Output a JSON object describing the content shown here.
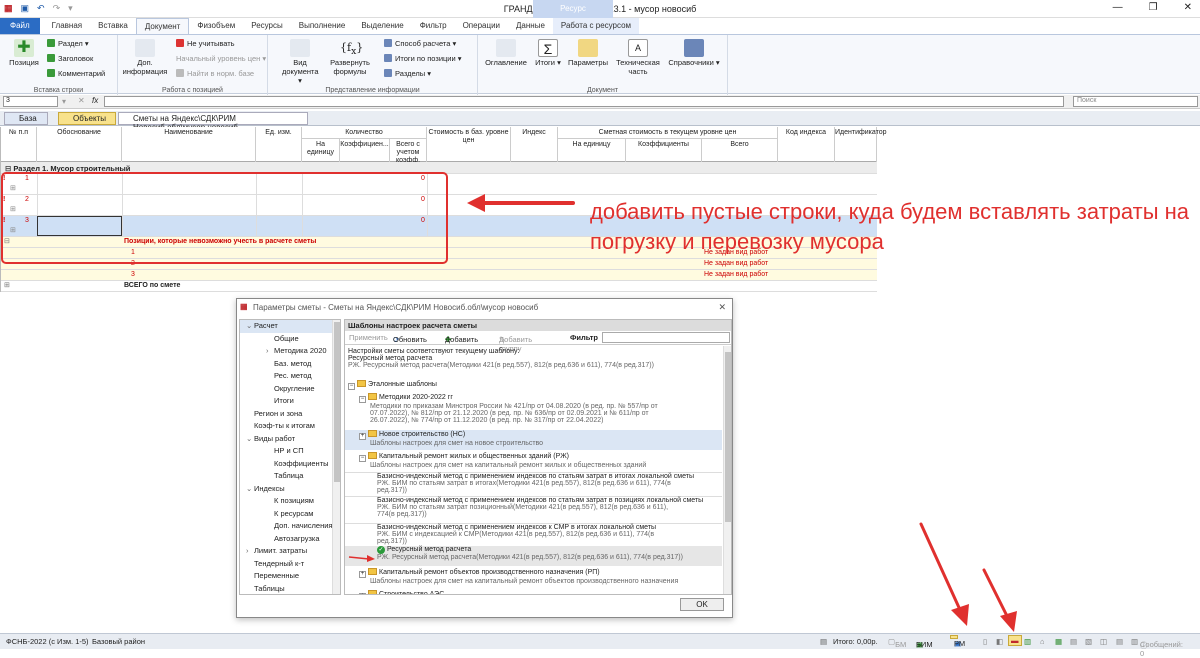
{
  "window": {
    "title": "ГРАНД-Смета, версия 2023.1 - мусор новосиб",
    "context_tab": "Ресурс",
    "controls": [
      "—",
      "❐",
      "✕"
    ]
  },
  "tabs": [
    "Файл",
    "Главная",
    "Вставка",
    "Документ",
    "Физобъем",
    "Ресурсы",
    "Выполнение",
    "Выделение",
    "Фильтр",
    "Операции",
    "Данные",
    "Работа с ресурсом"
  ],
  "ribbon": {
    "insert_row": {
      "position": "Позиция",
      "section": "Раздел",
      "header": "Заголовок",
      "comment": "Комментарий",
      "label": "Вставка строки"
    },
    "position_work": {
      "add_info": "Доп. информация",
      "no_count": "Не учитывать",
      "price_level": "Начальный уровень цен",
      "find_base": "Найти в норм. базе",
      "label": "Работа с позицией"
    },
    "info_view": {
      "doc_view": "Вид документа",
      "expand_formulas": "Развернуть формулы",
      "calc_method": "Способ расчета",
      "totals_pos": "Итоги по позиции",
      "sections": "Разделы",
      "label": "Представление информации"
    },
    "document": {
      "toc": "Оглавление",
      "totals": "Итоги",
      "params": "Параметры",
      "tech_part": "Техническая часть",
      "references": "Справочники",
      "label": "Документ"
    }
  },
  "formula_bar": {
    "cell": "3",
    "fx": "fx",
    "search_placeholder": "Поиск"
  },
  "doc_tabs": {
    "base": "База",
    "objects": "Объекты",
    "path": "Сметы на Яндекс\\СДК\\РИМ Новосиб.обл\\мусор новосиб"
  },
  "grid": {
    "headers": {
      "num": "№ п.п",
      "basis": "Обоснование",
      "name": "Наименование",
      "unit": "Ед. изм.",
      "qty": "Количество",
      "qty_per_unit": "На единицу",
      "qty_coef": "Коэффициен...",
      "qty_total": "Всего с учетом коэфф.",
      "base_cost": "Стоимость в баз. уровне цен",
      "index": "Индекс",
      "curr_cost": "Сметная стоимость в текущем уровне цен",
      "curr_unit": "На единицу",
      "curr_coef": "Коэффициенты",
      "curr_total": "Всего",
      "index_code": "Код индекса",
      "identifier": "Идентификатор"
    },
    "section": "Раздел 1. Мусор строительный",
    "rows": [
      {
        "num": "1",
        "value": "0"
      },
      {
        "num": "2",
        "value": "0"
      },
      {
        "num": "3",
        "value": "0"
      }
    ],
    "unaccounted": {
      "title": "Позиции, которые невозможно учесть в расчете сметы",
      "items": [
        {
          "num": "1",
          "note": "Не задан вид работ"
        },
        {
          "num": "2",
          "note": "Не задан вид работ"
        },
        {
          "num": "3",
          "note": "Не задан вид работ"
        }
      ]
    },
    "total": "ВСЕГО по смете"
  },
  "annotation": "добавить пустые строки, куда будем вставлять затраты на погрузку и перевозку мусора",
  "dialog": {
    "title": "Параметры сметы - Сметы на Яндекс\\СДК\\РИМ Новосиб.обл\\мусор новосиб",
    "tree": [
      {
        "label": "Расчет",
        "level": 0,
        "expanded": true,
        "selected": true
      },
      {
        "label": "Общие",
        "level": 1
      },
      {
        "label": "Методика 2020",
        "level": 1,
        "arrow": true
      },
      {
        "label": "Баз. метод",
        "level": 1
      },
      {
        "label": "Рес. метод",
        "level": 1
      },
      {
        "label": "Округление",
        "level": 1
      },
      {
        "label": "Итоги",
        "level": 1
      },
      {
        "label": "Регион и зона",
        "level": 0
      },
      {
        "label": "Коэф-ты к итогам",
        "level": 0
      },
      {
        "label": "Виды работ",
        "level": 0,
        "expanded": true
      },
      {
        "label": "НР и СП",
        "level": 1
      },
      {
        "label": "Коэффициенты",
        "level": 1
      },
      {
        "label": "Таблица",
        "level": 1
      },
      {
        "label": "Индексы",
        "level": 0,
        "expanded": true
      },
      {
        "label": "К позициям",
        "level": 1
      },
      {
        "label": "К ресурсам",
        "level": 1
      },
      {
        "label": "Доп. начисления",
        "level": 1
      },
      {
        "label": "Автозагрузка",
        "level": 1
      },
      {
        "label": "Лимит. затраты",
        "level": 0,
        "arrow": true
      },
      {
        "label": "Тендерный к-т",
        "level": 0
      },
      {
        "label": "Переменные",
        "level": 0
      },
      {
        "label": "Таблицы",
        "level": 0
      }
    ],
    "panel_title": "Шаблоны настроек расчета сметы",
    "toolbar": {
      "apply": "Применить",
      "refresh": "Обновить",
      "add": "Добавить",
      "add_group": "Добавить группу",
      "filter": "Фильтр"
    },
    "current_template": {
      "line1": "Настройки сметы соответствуют текущему шаблону:",
      "line2": "Ресурсный метод расчета",
      "line3": "РЖ. Ресурсный метод расчета(Методики 421(в ред.557), 812(в ред.636 и 611), 774(в ред.317))"
    },
    "items": [
      {
        "type": "folder",
        "title": "Эталонные шаблоны"
      },
      {
        "type": "folder",
        "title": "Методики 2020-2022 гг",
        "sub": "Методики по приказам Минстроя России № 421/пр от 04.08.2020 (в ред. пр. № 557/пр от 07.07.2022), № 812/пр от 21.12.2020 (в ред. пр. № 636/пр от 02.09.2021 и № 611/пр от 26.07.2022), № 774/пр от 11.12.2020 (в ред. пр. № 317/пр от 22.04.2022)"
      },
      {
        "type": "folder",
        "title": "Новое строительство (НС)",
        "sub": "Шаблоны настроек для смет на новое строительство"
      },
      {
        "type": "folder",
        "title": "Капитальный ремонт жилых и общественных зданий (РЖ)",
        "sub": "Шаблоны настроек для смет на капитальный ремонт жилых и общественных зданий"
      },
      {
        "type": "item",
        "title": "Базисно-индексный метод с применением индексов по статьям затрат в итогах локальной сметы",
        "sub": "РЖ. БИМ по статьям затрат в итогах(Методики 421(в ред.557), 812(в ред.636 и 611), 774(в ред.317))"
      },
      {
        "type": "item",
        "title": "Базисно-индексный метод с применением индексов по статьям затрат в позициях локальной сметы",
        "sub": "РЖ. БИМ по статьям затрат позиционный(Методики 421(в ред.557), 812(в ред.636 и 611), 774(в ред.317))"
      },
      {
        "type": "item",
        "title": "Базисно-индексный метод с применением индексов к СМР в итогах локальной сметы",
        "sub": "РЖ. БИМ с индексацией к СМР(Методики 421(в ред.557), 812(в ред.636 и 611), 774(в ред.317))"
      },
      {
        "type": "item-check",
        "title": "Ресурсный метод расчета",
        "sub": "РЖ. Ресурсный метод расчета(Методики 421(в ред.557), 812(в ред.636 и 611), 774(в ред.317))"
      },
      {
        "type": "folder",
        "title": "Капитальный ремонт объектов производственного назначения (РП)",
        "sub": "Шаблоны настроек для смет на капитальный ремонт объектов производственного назначения"
      },
      {
        "type": "folder",
        "title": "Строительство АЭС"
      }
    ],
    "ok": "OK"
  },
  "status": {
    "base": "ФСНБ-2022 (с Изм. 1-5)",
    "region": "Базовый район",
    "total": "Итого: 0,00р.",
    "bm": "БМ",
    "bim": "БИМ",
    "rm": "РМ",
    "messages": "Сообщений: 0"
  },
  "colors": {
    "accent": "#2b6cc4",
    "annotation": "#e0302e",
    "highlight": "#f8e28c"
  }
}
